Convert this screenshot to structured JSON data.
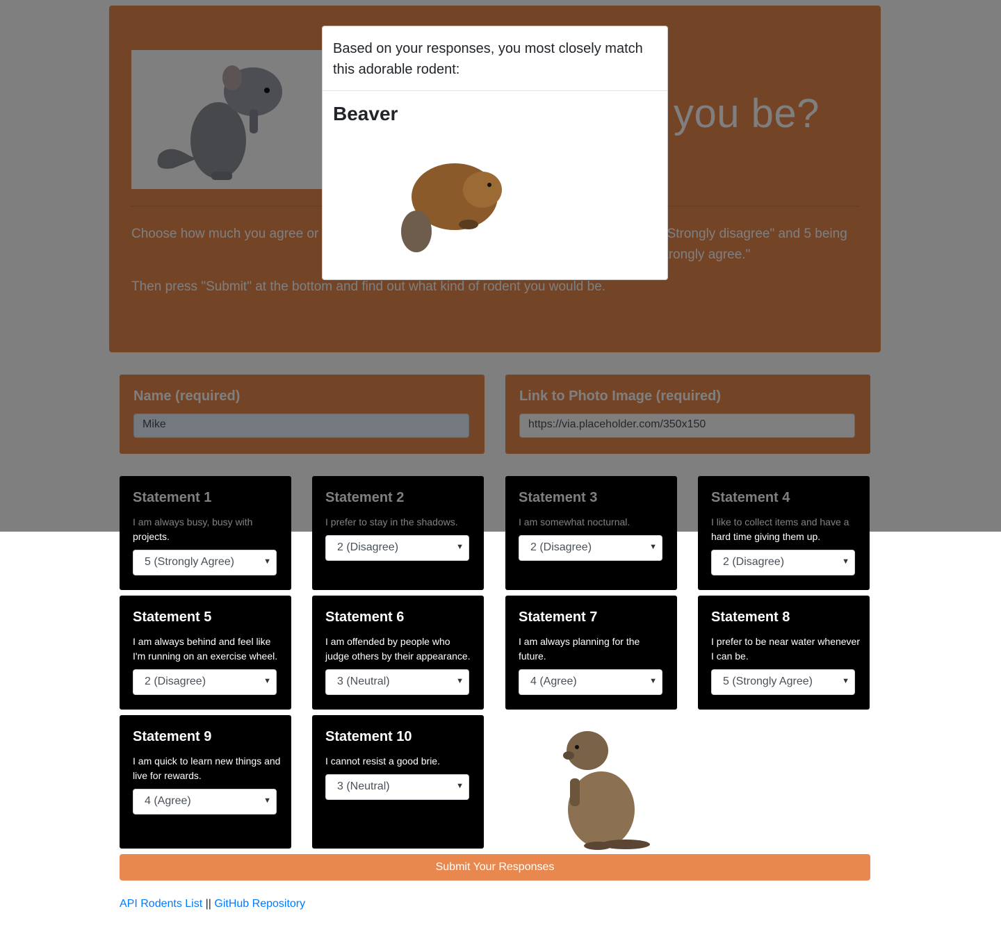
{
  "hero": {
    "title": "you be?",
    "instructions_start": "Choose how much you agree or",
    "instructions_end": "g \"Strongly disagree\" and 5 being \"Strongly agree.\"",
    "instructions_2": "Then press \"Submit\" at the bottom and find out what kind of rodent you would be.",
    "image_icon": "chinchilla-image"
  },
  "form": {
    "name_label": "Name (required)",
    "name_value": "Mike",
    "photo_label": "Link to Photo Image (required)",
    "photo_value": "https://via.placeholder.com/350x150"
  },
  "statements": [
    {
      "title": "Statement 1",
      "text": "I am always busy, busy with projects.",
      "value": "5 (Strongly Agree)"
    },
    {
      "title": "Statement 2",
      "text": "I prefer to stay in the shadows.",
      "value": "2 (Disagree)"
    },
    {
      "title": "Statement 3",
      "text": "I am somewhat nocturnal.",
      "value": "2 (Disagree)"
    },
    {
      "title": "Statement 4",
      "text": "I like to collect items and have a hard time giving them up.",
      "value": "2 (Disagree)"
    },
    {
      "title": "Statement 5",
      "text": "I am always behind and feel like I'm running on an exercise wheel.",
      "value": "2 (Disagree)"
    },
    {
      "title": "Statement 6",
      "text": "I am offended by people who judge others by their appearance.",
      "value": "3 (Neutral)"
    },
    {
      "title": "Statement 7",
      "text": "I am always planning for the future.",
      "value": "4 (Agree)"
    },
    {
      "title": "Statement 8",
      "text": "I prefer to be near water whenever I can be.",
      "value": "5 (Strongly Agree)"
    },
    {
      "title": "Statement 9",
      "text": "I am quick to learn new things and live for rewards.",
      "value": "4 (Agree)"
    },
    {
      "title": "Statement 10",
      "text": "I cannot resist a good brie.",
      "value": "3 (Neutral)"
    }
  ],
  "submit_label": "Submit Your Responses",
  "footer": {
    "link1": "API Rodents List",
    "separator": "||",
    "link2": "GitHub Repository"
  },
  "modal": {
    "header": "Based on your responses, you most closely match this adorable rodent:",
    "result_name": "Beaver",
    "result_image_icon": "beaver-image"
  },
  "colors": {
    "accent": "#e9884e",
    "card": "#000000",
    "link": "#007bff"
  }
}
